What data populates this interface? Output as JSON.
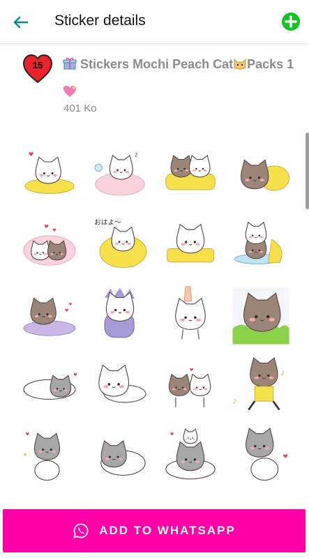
{
  "appbar": {
    "title": "Sticker details",
    "back_icon": "arrow-back-icon",
    "add_icon": "add-circle-icon",
    "accent": "#0a8a82",
    "add_color": "#18c224"
  },
  "pack": {
    "badge_number": "15",
    "badge_color": "#e8232c",
    "title": "Stickers Mochi Peach Cat",
    "title_suffix": "Packs 1",
    "size": "401 Ko"
  },
  "stickers": [
    {
      "name": "sticker-cat-sleeping-pillow"
    },
    {
      "name": "sticker-cat-blanket-bed"
    },
    {
      "name": "sticker-cats-yellow-blanket"
    },
    {
      "name": "sticker-cat-under-blanket"
    },
    {
      "name": "sticker-cats-pink-blanket"
    },
    {
      "name": "sticker-cat-ohayo"
    },
    {
      "name": "sticker-cat-tired-pillow"
    },
    {
      "name": "sticker-cats-stacked-pillow"
    },
    {
      "name": "sticker-cat-purple-cushion"
    },
    {
      "name": "sticker-cat-dino-costume"
    },
    {
      "name": "sticker-cat-held-up"
    },
    {
      "name": "sticker-cat-in-grass"
    },
    {
      "name": "sticker-grey-cat-lying"
    },
    {
      "name": "sticker-cat-lying-happy"
    },
    {
      "name": "sticker-cats-hugging"
    },
    {
      "name": "sticker-cat-dancing-music"
    },
    {
      "name": "sticker-grey-cat-laughing"
    },
    {
      "name": "sticker-grey-cat-rolling"
    },
    {
      "name": "sticker-grey-cats-stacked"
    },
    {
      "name": "sticker-grey-cat-dancing"
    }
  ],
  "ohayo_text": "おはよ〜",
  "action": {
    "label": "ADD TO WHATSAPP",
    "icon": "whatsapp-icon",
    "color": "#ff00a8"
  }
}
